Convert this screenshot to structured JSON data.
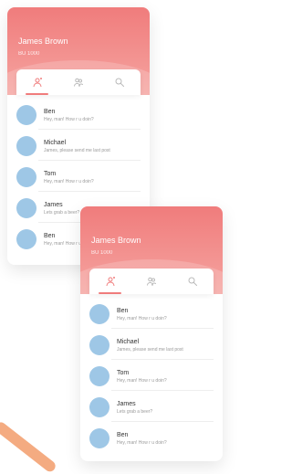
{
  "user": {
    "name": "James Brown",
    "status": "BU 1000"
  },
  "tabs": [
    {
      "icon": "user-icon"
    },
    {
      "icon": "group-icon"
    },
    {
      "icon": "search-icon"
    }
  ],
  "chats": [
    {
      "name": "Ben",
      "message": "Hey, man! How r u doin?"
    },
    {
      "name": "Michael",
      "message": "James, please send me last post"
    },
    {
      "name": "Tom",
      "message": "Hey, man! How r u doin?"
    },
    {
      "name": "James",
      "message": "Lets grab a beer?"
    },
    {
      "name": "Ben",
      "message": "Hey, man! How r u doin?"
    }
  ],
  "colors": {
    "accent": "#f07c7c",
    "avatar": "#9ec7e6",
    "stroke": "#f3a273"
  }
}
